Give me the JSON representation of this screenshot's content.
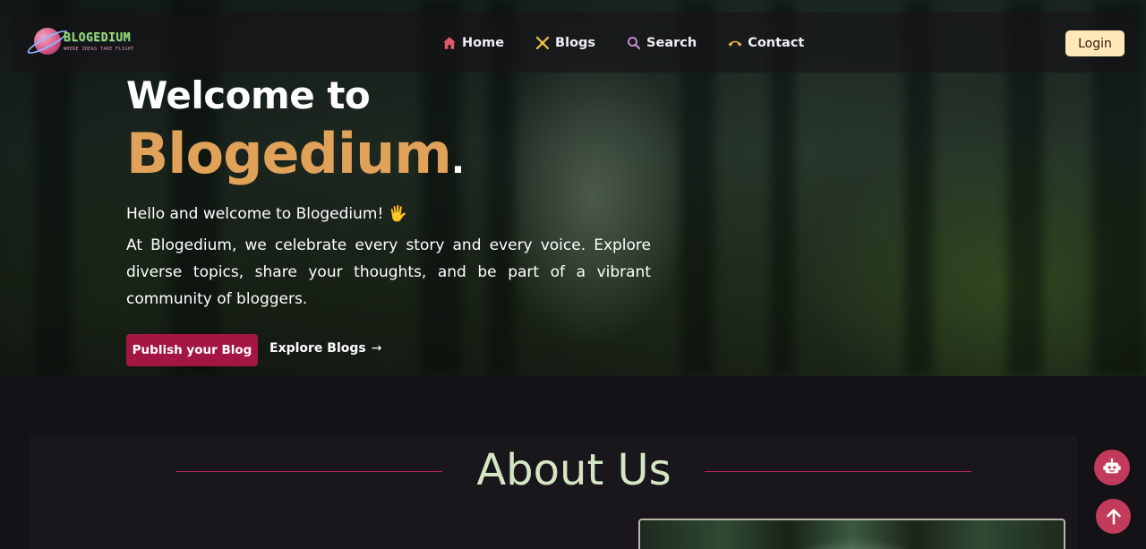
{
  "nav": {
    "logo": {
      "name": "BLOGEDIUM",
      "tagline": "WHERE IDEAS TAKE FLIGHT"
    },
    "items": [
      {
        "label": "Home",
        "icon": "home-icon",
        "color": "#e05a6b"
      },
      {
        "label": "Blogs",
        "icon": "blogs-icon",
        "color": "#f0c24a"
      },
      {
        "label": "Search",
        "icon": "search-icon",
        "color": "#c98ad8"
      },
      {
        "label": "Contact",
        "icon": "contact-icon",
        "color": "#f2b64a"
      }
    ],
    "login_label": "Login"
  },
  "hero": {
    "title_line1": "Welcome to",
    "title_brand": "Blogedium",
    "title_dot": ".",
    "greeting": "Hello and welcome to Blogedium! 🖐",
    "description": "At Blogedium, we celebrate every story and every voice. Explore diverse topics, share your thoughts, and be part of a vibrant community of bloggers.",
    "primary_button": "Publish your Blog",
    "secondary_link": "Explore Blogs",
    "secondary_arrow": "→"
  },
  "about": {
    "title": "About Us"
  },
  "fabs": {
    "chat_icon": "robot-icon",
    "top_icon": "arrow-up-icon"
  },
  "colors": {
    "accent": "#a41642",
    "brand_gold": "#e0a158",
    "about_title": "#d5e6c4",
    "fab": "#c33b5a",
    "login_bg": "#ffe7b8"
  }
}
